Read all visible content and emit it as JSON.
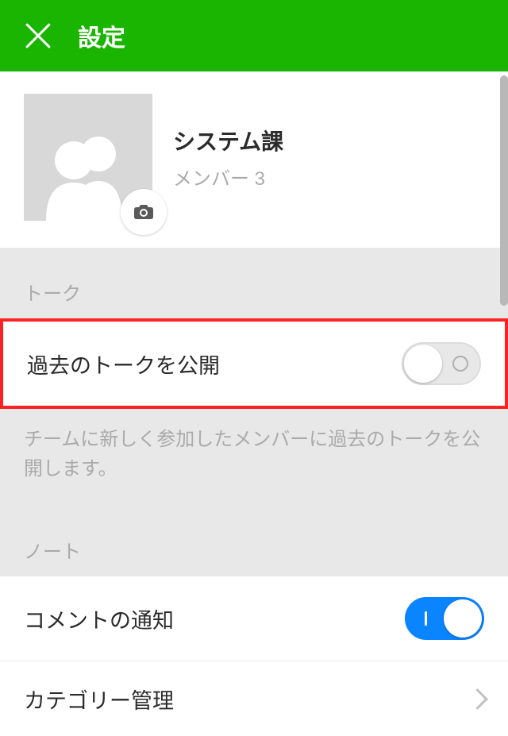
{
  "header": {
    "title": "設定"
  },
  "profile": {
    "name": "システム課",
    "member_label": "メンバー 3"
  },
  "sections": {
    "talk": {
      "label": "トーク",
      "expose_past": {
        "label": "過去のトークを公開",
        "enabled": false,
        "description": "チームに新しく参加したメンバーに過去のトークを公開します。"
      }
    },
    "note": {
      "label": "ノート",
      "comment_notify": {
        "label": "コメントの通知",
        "enabled": true
      },
      "category_manage": {
        "label": "カテゴリー管理"
      }
    }
  }
}
